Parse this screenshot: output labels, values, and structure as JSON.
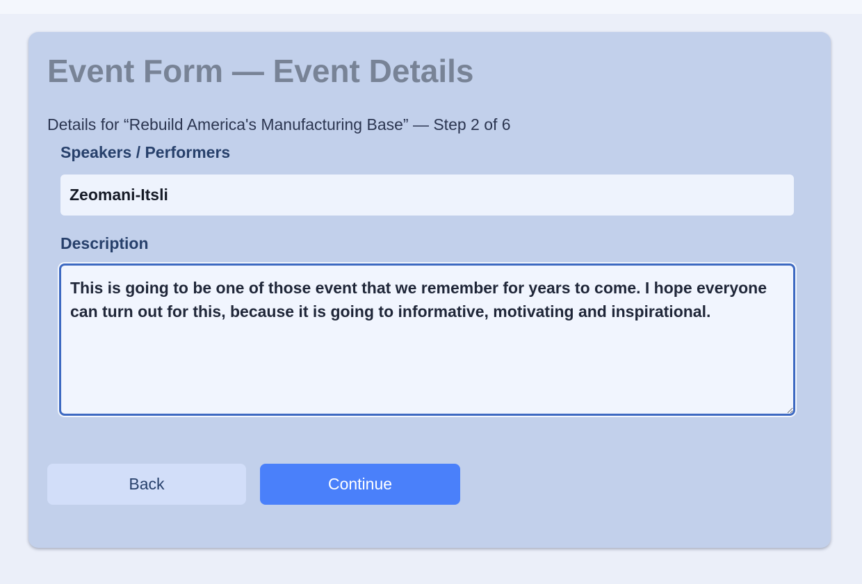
{
  "form": {
    "title": "Event Form — Event Details",
    "subtitle": "Details for “Rebuild America's Manufacturing Base” — Step 2 of 6",
    "fields": {
      "speakers": {
        "label": "Speakers / Performers",
        "value": "Zeomani-Itsli"
      },
      "description": {
        "label": "Description",
        "value": "This is going to be one of those event that we remember for years to come. I hope everyone can turn out for this, because it is going to informative, motivating and inspirational."
      }
    },
    "buttons": {
      "back_label": "Back",
      "continue_label": "Continue"
    }
  },
  "colors": {
    "page_background": "#ebeff9",
    "card_background": "#c2d0eb",
    "title_text": "#788396",
    "label_text": "#27406b",
    "focus_border": "#3d69c1",
    "primary_button": "#4a80fa",
    "secondary_button": "#d2def9"
  }
}
